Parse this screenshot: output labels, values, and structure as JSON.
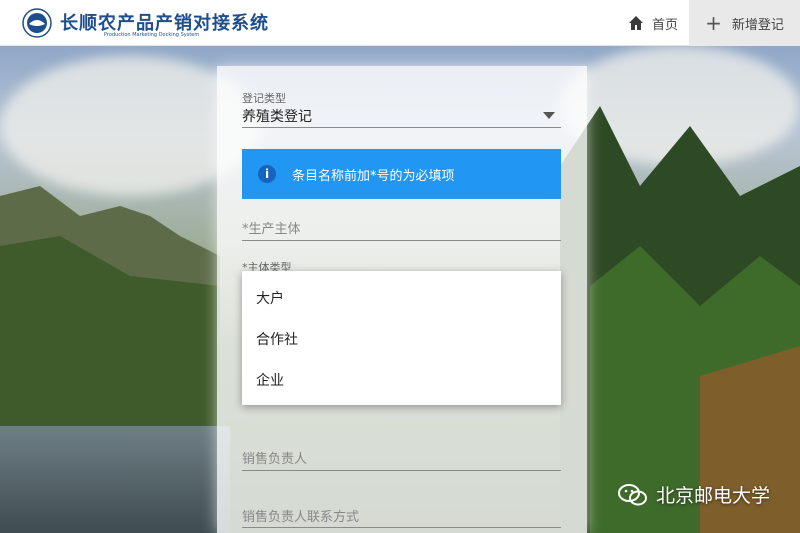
{
  "header": {
    "title": "长顺农产品产销对接系统",
    "subtitle": "Production Marketing Docking System",
    "nav_home_label": "首页",
    "nav_add_label": "新增登记"
  },
  "form": {
    "reg_type_label": "登记类型",
    "reg_type_value": "养殖类登记",
    "info_message": "条目名称前加*号的为必填项",
    "producer_placeholder": "*生产主体",
    "entity_type_label": "*主体类型",
    "entity_type_options": [
      "大户",
      "合作社",
      "企业"
    ],
    "sales_person_placeholder": "销售负责人",
    "sales_contact_placeholder": "销售负责人联系方式"
  },
  "watermark": {
    "text": "北京邮电大学"
  },
  "colors": {
    "brand_blue": "#1f4e8c",
    "info_blue": "#2196f3"
  },
  "icons": {
    "home": "home-icon",
    "add": "plus-icon",
    "info": "info-icon",
    "dropdown": "caret-down-icon",
    "wechat": "wechat-icon"
  }
}
